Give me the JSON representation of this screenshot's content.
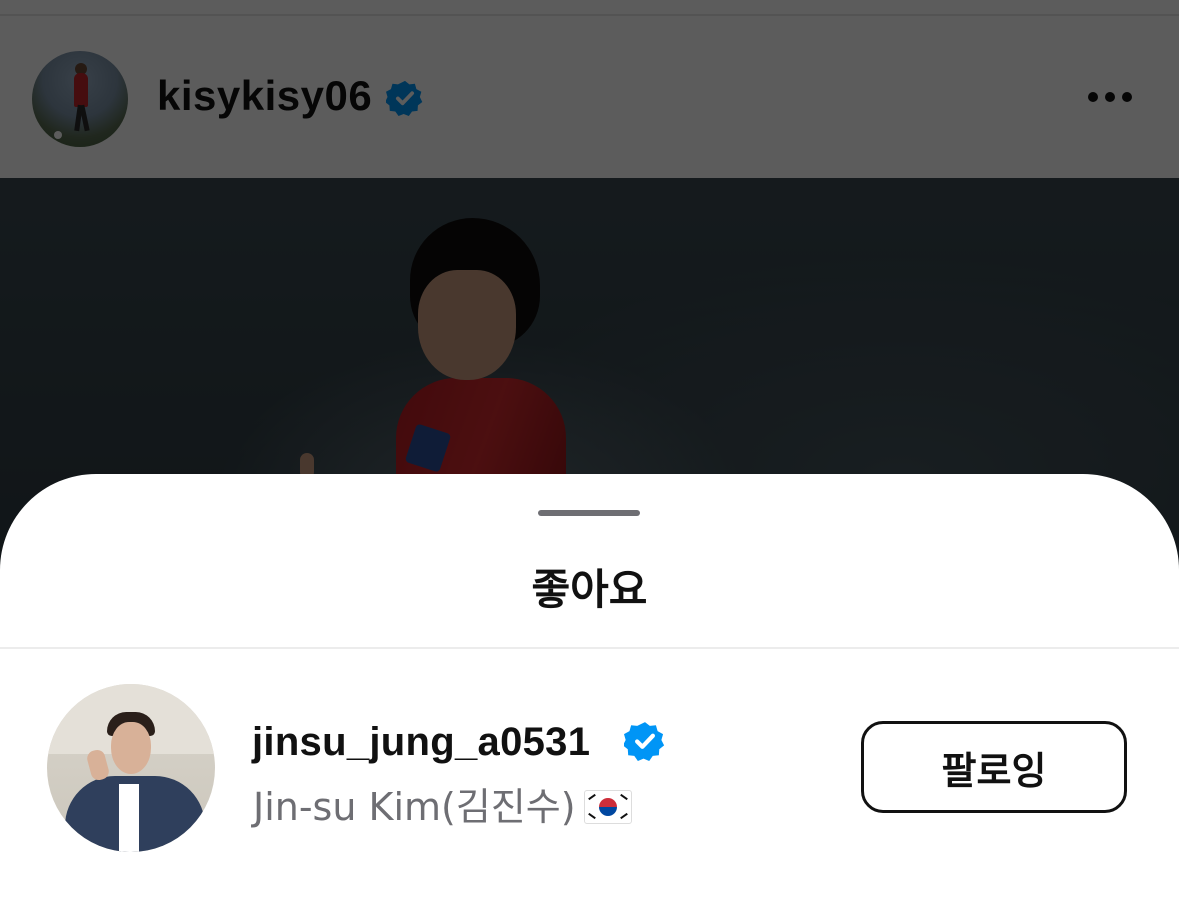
{
  "post": {
    "username": "kisykisy06",
    "verified": true,
    "more_icon": "more-horizontal-icon"
  },
  "likes_sheet": {
    "title": "좋아요",
    "users": [
      {
        "username": "jinsu_jung_a0531",
        "verified": true,
        "full_name": "Jin-su Kim(김진수)",
        "flag": "south-korea-flag",
        "button_label": "팔로잉"
      }
    ]
  },
  "colors": {
    "verified_blue": "#0095f6",
    "overlay": "rgba(0,0,0,0.64)"
  }
}
